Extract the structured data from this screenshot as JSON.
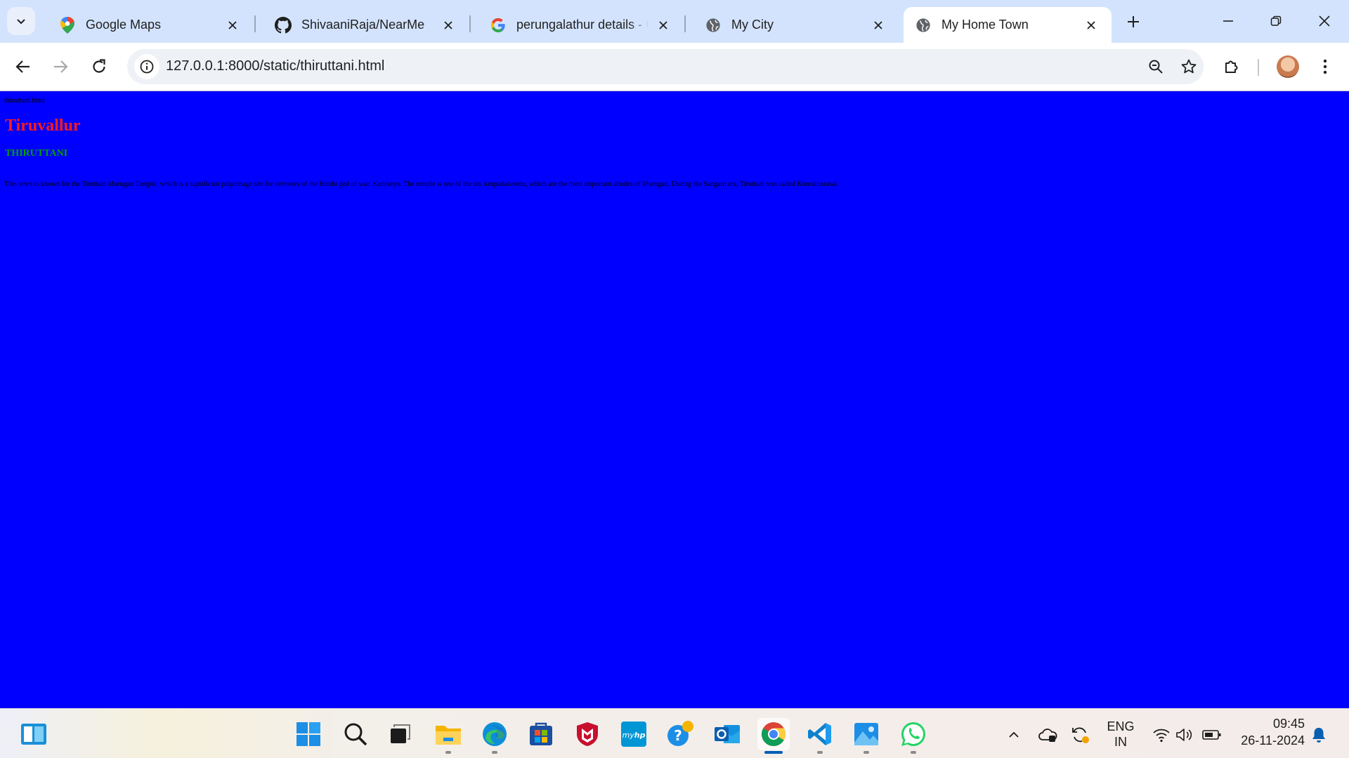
{
  "browser": {
    "tabs": [
      {
        "title": "Google Maps",
        "icon": "google-maps-pin-icon",
        "active": false
      },
      {
        "title": "ShivaaniRaja/NearMe",
        "icon": "github-icon",
        "active": false
      },
      {
        "title": "perungalathur details - G",
        "icon": "google-g-icon",
        "active": false
      },
      {
        "title": "My City",
        "icon": "globe-icon",
        "active": false
      },
      {
        "title": "My Home Town",
        "icon": "globe-icon",
        "active": true
      }
    ],
    "url": "127.0.0.1:8000/static/thiruttani.html"
  },
  "page": {
    "filename": "thiruttani.html",
    "heading": "Tiruvallur",
    "subheading": "THIRUTTANI",
    "paragraph": "This town is known for the Tiruttani Murugan Temple, which is a significant pilgrimage site for devotees of the Hindu god of war, Kartikeya. The temple is one of the six Arupadaiveedu, which are the most important abodes of Murugan. During the Sangam era, Tiruttani was called Kunrathorasal.",
    "colors": {
      "background": "#0000ff",
      "heading": "#ff1a1a",
      "subheading": "#00a000",
      "text": "#000000"
    }
  },
  "taskbar": {
    "apps": [
      "widgets-icon",
      "windows-start-icon",
      "search-icon",
      "task-view-icon",
      "file-explorer-icon",
      "edge-icon",
      "microsoft-store-icon",
      "mcafee-icon",
      "myhp-icon",
      "get-help-icon",
      "outlook-icon",
      "chrome-icon",
      "vscode-icon",
      "photos-icon",
      "whatsapp-icon"
    ],
    "language_line1": "ENG",
    "language_line2": "IN",
    "time": "09:45",
    "date": "26-11-2024"
  }
}
